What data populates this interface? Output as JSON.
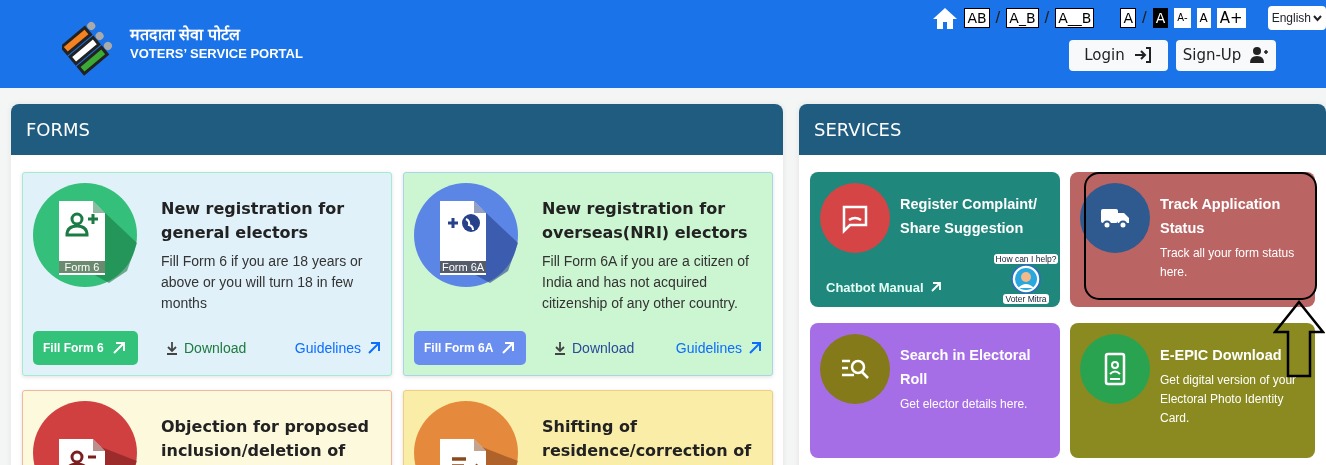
{
  "header": {
    "title_hindi": "मतदाता सेवा पोर्टल",
    "title": "VOTERS’ SERVICE PORTAL"
  },
  "toolbar": [
    {
      "kind": "spacing",
      "label": "AB",
      "inverted": false
    },
    {
      "kind": "sep",
      "label": "/"
    },
    {
      "kind": "spacing",
      "label": "A_B",
      "inverted": false
    },
    {
      "kind": "sep",
      "label": "/"
    },
    {
      "kind": "spacing",
      "label": "A__B",
      "inverted": false
    },
    {
      "kind": "gap"
    },
    {
      "kind": "contrast",
      "label": "A",
      "inverted": false
    },
    {
      "kind": "sep",
      "label": "/"
    },
    {
      "kind": "contrast",
      "label": "A",
      "inverted": true
    },
    {
      "kind": "size",
      "label": "A-",
      "inverted": false
    },
    {
      "kind": "size",
      "label": "A",
      "inverted": false
    },
    {
      "kind": "size",
      "label": "A+",
      "inverted": false
    }
  ],
  "language": "English",
  "auth_buttons": [
    {
      "label": "Login"
    },
    {
      "label": "Sign-Up"
    }
  ],
  "forms": {
    "title": "FORMS",
    "cards": [
      {
        "badge": "Form 6",
        "title": "New registration for general electors",
        "description": "Fill Form 6 if you are 18 years or above or you will turn 18 in few months",
        "button": "Fill Form 6",
        "download": "Download",
        "guidelines": "Guidelines"
      },
      {
        "badge": "Form 6A",
        "title": "New registration for overseas(NRI) electors",
        "description": "Fill Form 6A if you are a citizen of India and has not acquired citizenship of any other country.",
        "button": "Fill Form 6A",
        "download": "Download",
        "guidelines": "Guidelines"
      },
      {
        "title": "Objection for proposed inclusion/deletion of"
      },
      {
        "title": "Shifting of residence/correction of"
      }
    ]
  },
  "services": {
    "title": "SERVICES",
    "cards": [
      {
        "title": "Register Complaint/ Share Suggestion",
        "link": "Chatbot Manual",
        "badge_top": "How can I help?",
        "badge_bottom": "Voter Mitra",
        "highlighted": false
      },
      {
        "title": "Track Application Status",
        "description": "Track all your form status here.",
        "highlighted": true
      },
      {
        "title": "Search in Electoral Roll",
        "description": "Get elector details here.",
        "highlighted": false
      },
      {
        "title": "E-EPIC Download",
        "description": "Get digital version of your Electoral Photo Identity Card.",
        "highlighted": false
      }
    ]
  }
}
